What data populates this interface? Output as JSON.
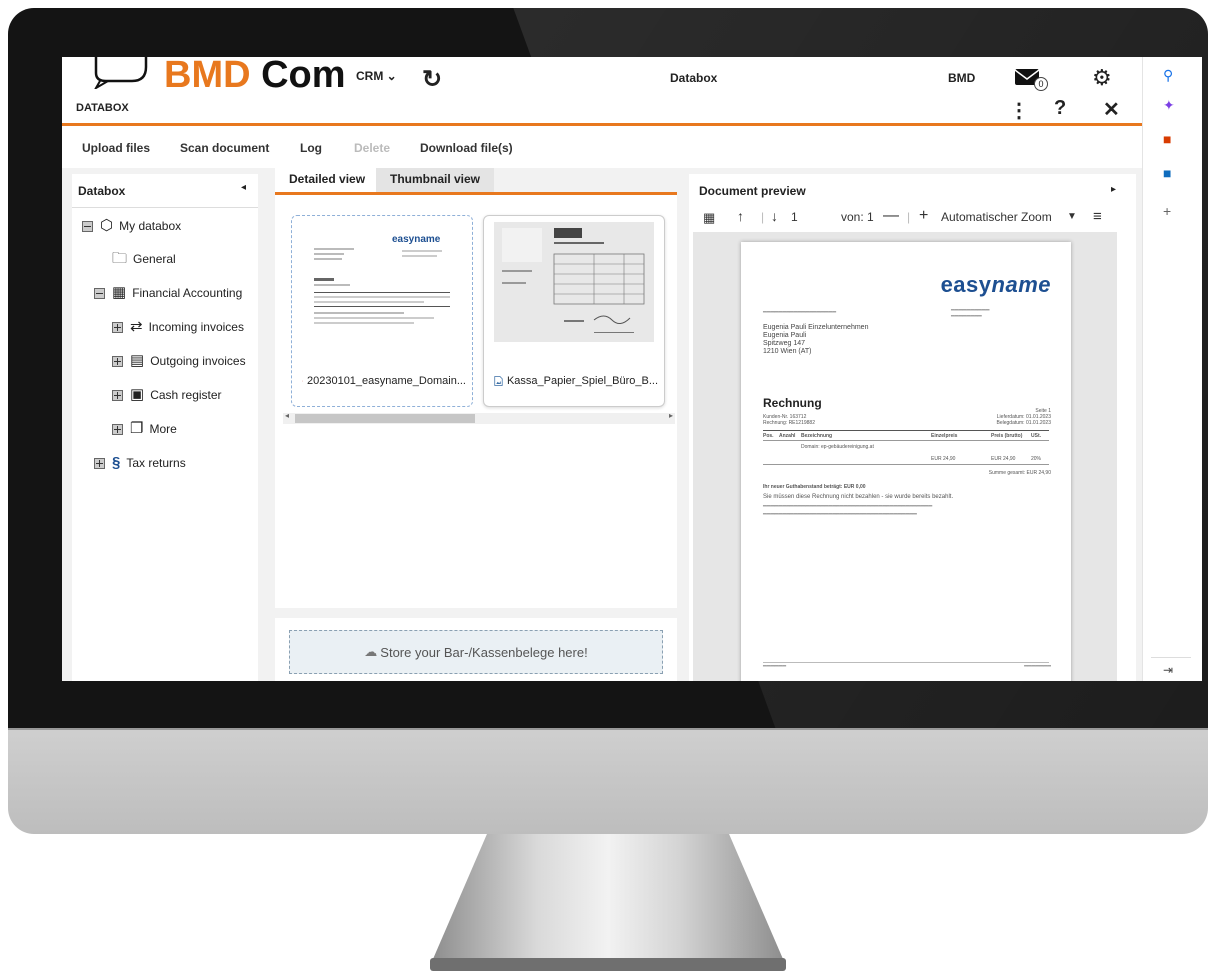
{
  "app": {
    "logo_bmd": "BMD",
    "logo_com": "Com",
    "module": "DATABOX",
    "crm": "CRM",
    "center_title": "Databox",
    "user": "BMD",
    "mail_count": "0"
  },
  "toolbar": {
    "upload": "Upload files",
    "scan": "Scan document",
    "log": "Log",
    "delete": "Delete",
    "download": "Download file(s)"
  },
  "tree": {
    "title": "Databox",
    "nodes": [
      {
        "label": "My databox"
      },
      {
        "label": "General"
      },
      {
        "label": "Financial Accounting"
      },
      {
        "label": "Incoming invoices"
      },
      {
        "label": "Outgoing invoices"
      },
      {
        "label": "Cash register"
      },
      {
        "label": "More"
      },
      {
        "label": "Tax returns"
      }
    ]
  },
  "view": {
    "tab_detailed": "Detailed view",
    "tab_thumbnail": "Thumbnail view",
    "files": [
      {
        "name": "20230101_easyname_Domain..."
      },
      {
        "name": "Kassa_Papier_Spiel_Büro_B..."
      }
    ],
    "dropzone": "Store your Bar-/Kassenbelege here!"
  },
  "preview": {
    "title": "Document preview",
    "page_current": "1",
    "page_of": "von: 1",
    "zoom": "Automatischer Zoom",
    "doc": {
      "brand_a": "easy",
      "brand_b": "name",
      "recipient_name": "Eugenia Pauli Einzelunternehmen",
      "recipient_1": "Eugenia Pauli",
      "recipient_2": "Spitzweg 147",
      "recipient_3": "1210 Wien (AT)",
      "heading": "Rechnung",
      "note": "Sie müssen diese Rechnung nicht bezahlen - sie wurde bereits bezahlt.",
      "col_pos": "Pos.",
      "col_qty": "Anzahl",
      "col_desc": "Bezeichnung",
      "col_unit": "Einzelpreis",
      "col_price": "Preis (brutto)",
      "col_vat": "USt.",
      "row_desc": "Domain: ep-gebäudereinigung.at",
      "row_unit": "EUR 24,90",
      "row_price": "EUR 24,90",
      "row_vat": "20%",
      "total": "Summe gesamt: EUR 24,90",
      "balance": "Ihr neuer Guthabenstand beträgt: EUR 0,00",
      "customer_no": "Kunden-Nr. 163712",
      "invoice_no": "Rechnung: RE1219882",
      "delivery": "Lieferdatum: 01.01.2023",
      "invoice_date": "Belegdatum: 01.01.2023",
      "page": "Seite 1"
    }
  },
  "colors": {
    "accent": "#e8781e",
    "brand_blue": "#1d4f91"
  }
}
